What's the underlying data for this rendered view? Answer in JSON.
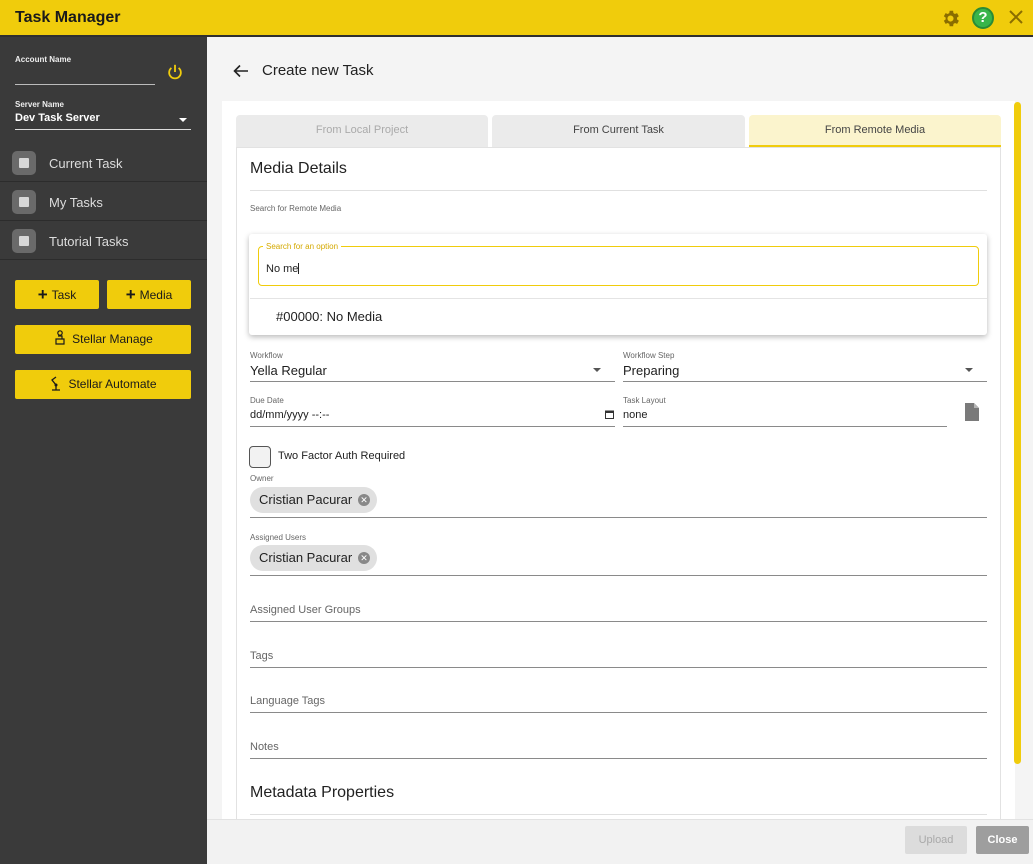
{
  "app": {
    "title": "Task Manager"
  },
  "sidebar": {
    "account_label": "Account Name",
    "server_label": "Server Name",
    "server_value": "Dev Task Server",
    "nav": [
      {
        "label": "Current Task",
        "icon": "briefcase-icon"
      },
      {
        "label": "My Tasks",
        "icon": "list-icon"
      },
      {
        "label": "Tutorial Tasks",
        "icon": "graduation-cap-icon"
      }
    ],
    "buttons": {
      "task": "Task",
      "media": "Media",
      "stellar_manage": "Stellar Manage",
      "stellar_automate": "Stellar Automate"
    }
  },
  "header": {
    "title": "Create new Task"
  },
  "tabs": [
    {
      "label": "From Local Project",
      "state": "disabled"
    },
    {
      "label": "From Current Task",
      "state": "normal"
    },
    {
      "label": "From Remote Media",
      "state": "active"
    }
  ],
  "media_details": {
    "title": "Media Details",
    "search_label": "Search for Remote Media",
    "search": {
      "legend": "Search for an option",
      "value": "No me",
      "options": [
        "#00000: No Media"
      ]
    }
  },
  "form": {
    "workflow_label": "Workflow",
    "workflow_value": "Yella Regular",
    "workflow_step_label": "Workflow Step",
    "workflow_step_value": "Preparing",
    "due_date_label": "Due Date",
    "due_date_value": "dd/mm/yyyy --:--",
    "task_layout_label": "Task Layout",
    "task_layout_value": "none",
    "two_factor_label": "Two Factor Auth Required",
    "owner_label": "Owner",
    "owner_chip": "Cristian Pacurar",
    "assigned_users_label": "Assigned Users",
    "assigned_users_chip": "Cristian Pacurar",
    "assigned_user_groups": "Assigned User Groups",
    "tags": "Tags",
    "language_tags": "Language Tags",
    "notes": "Notes"
  },
  "metadata": {
    "title": "Metadata Properties"
  },
  "footer": {
    "upload": "Upload",
    "close": "Close"
  },
  "colors": {
    "accent": "#f0cc0c",
    "sidebar": "#3a3a3a",
    "help": "#39b54a"
  }
}
